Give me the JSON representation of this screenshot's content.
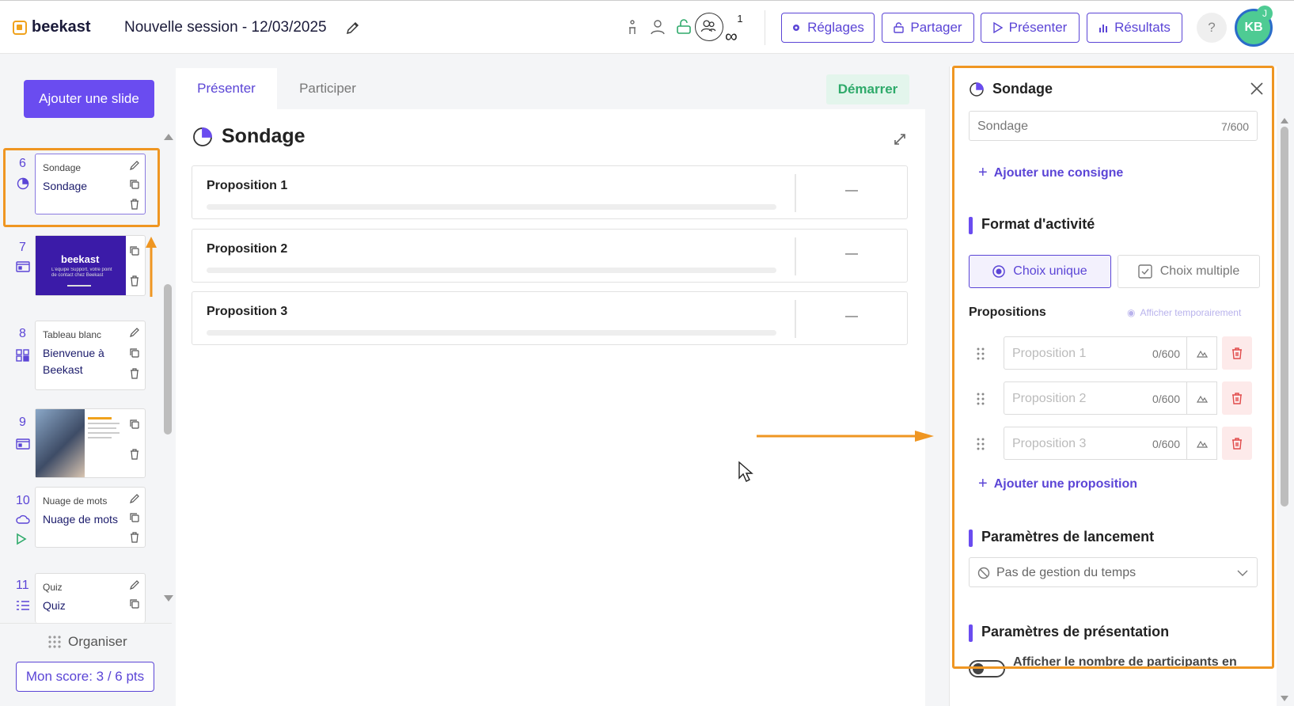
{
  "header": {
    "brand": "beekast",
    "session_title": "Nouvelle session - 12/03/2025",
    "participants_count": "1",
    "participants_limit": "∞",
    "buttons": {
      "settings": "Réglages",
      "share": "Partager",
      "present": "Présenter",
      "results": "Résultats"
    },
    "help": "?",
    "avatar_initials": "KB",
    "avatar_badge": "J"
  },
  "sidebar": {
    "add_slide": "Ajouter une slide",
    "slides": [
      {
        "num": "6",
        "type": "Sondage",
        "title": "Sondage"
      },
      {
        "num": "7",
        "type": "",
        "title": "",
        "thumb_brand": "beekast",
        "thumb_text": "L'équipe Support, votre point de contact chez Beekast"
      },
      {
        "num": "8",
        "type": "Tableau blanc",
        "title": "Bienvenue à Beekast"
      },
      {
        "num": "9",
        "type": "",
        "title": ""
      },
      {
        "num": "10",
        "type": "Nuage de mots",
        "title": "Nuage de mots"
      },
      {
        "num": "11",
        "type": "Quiz",
        "title": "Quiz"
      }
    ],
    "organise": "Organiser",
    "score": "Mon score: 3 / 6 pts"
  },
  "main": {
    "tabs": [
      "Présenter",
      "Participer"
    ],
    "start": "Démarrer",
    "title": "Sondage",
    "propositions": [
      {
        "label": "Proposition 1",
        "value": "—"
      },
      {
        "label": "Proposition 2",
        "value": "—"
      },
      {
        "label": "Proposition 3",
        "value": "—"
      }
    ]
  },
  "panel": {
    "title": "Sondage",
    "question_value": "Sondage",
    "question_count": "7/600",
    "add_instruction": "Ajouter une consigne",
    "format_title": "Format d'activité",
    "single_choice": "Choix unique",
    "multiple_choice": "Choix multiple",
    "propositions_label": "Propositions",
    "show_temp": "Afficher temporairement",
    "items": [
      {
        "placeholder": "Proposition 1",
        "count": "0/600"
      },
      {
        "placeholder": "Proposition 2",
        "count": "0/600"
      },
      {
        "placeholder": "Proposition 3",
        "count": "0/600"
      }
    ],
    "add_proposition": "Ajouter une proposition",
    "launch_title": "Paramètres de lancement",
    "time_option": "Pas de gestion du temps",
    "presentation_title": "Paramètres de présentation",
    "show_participants": "Afficher le nombre de participants en"
  },
  "colors": {
    "accent": "#5b45d6",
    "highlight": "#ef9622",
    "start_green": "#2eaa6a"
  }
}
